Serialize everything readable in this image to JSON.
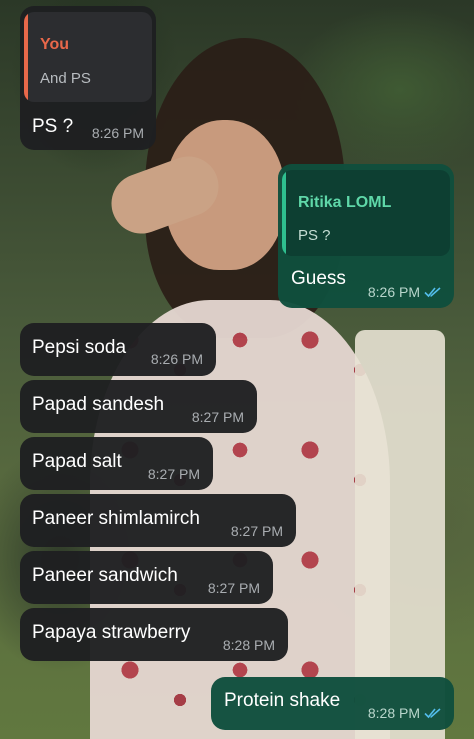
{
  "colors": {
    "incoming_bubble": "#1e1f21",
    "outgoing_bubble": "#104e3d",
    "quote_you_bar": "#e8684a",
    "quote_you_name": "#e8684a",
    "quote_other_bar": "#2fbf8f",
    "quote_other_name": "#5fd8a9",
    "read_ticks": "#53bdeb"
  },
  "messages": [
    {
      "direction": "incoming",
      "quote": {
        "author": "You",
        "text": "And PS"
      },
      "text": "PS ?",
      "time": "8:26 PM"
    },
    {
      "direction": "outgoing",
      "quote": {
        "author": "Ritika LOML",
        "text": "PS ?"
      },
      "text": "Guess",
      "time": "8:26 PM",
      "status_icon": "double-check-read-icon"
    },
    {
      "direction": "incoming",
      "text": "Pepsi soda",
      "time": "8:26 PM"
    },
    {
      "direction": "incoming",
      "text": "Papad sandesh",
      "time": "8:27 PM"
    },
    {
      "direction": "incoming",
      "text": "Papad salt",
      "time": "8:27 PM"
    },
    {
      "direction": "incoming",
      "text": "Paneer shimlamirch",
      "time": "8:27 PM"
    },
    {
      "direction": "incoming",
      "text": "Paneer sandwich",
      "time": "8:27 PM"
    },
    {
      "direction": "incoming",
      "text": "Papaya strawberry",
      "time": "8:28 PM"
    },
    {
      "direction": "outgoing",
      "text": "Protein shake",
      "time": "8:28 PM",
      "status_icon": "double-check-read-icon"
    }
  ]
}
